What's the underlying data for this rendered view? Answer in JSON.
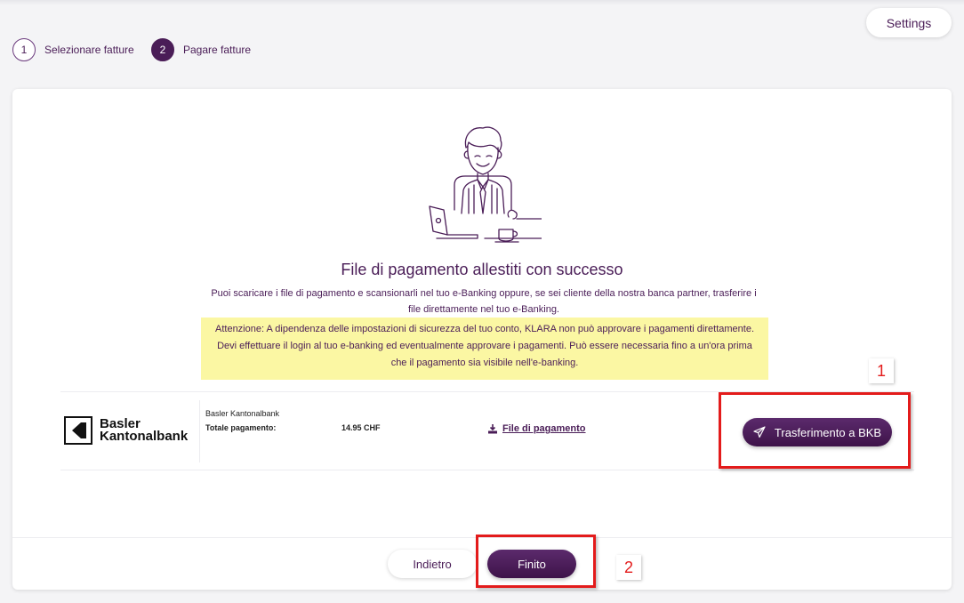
{
  "header": {
    "settings_label": "Settings"
  },
  "steps": [
    {
      "number": "1",
      "label": "Selezionare fatture"
    },
    {
      "number": "2",
      "label": "Pagare fatture"
    }
  ],
  "main": {
    "title": "File di pagamento allestiti con successo",
    "description_line1": "Puoi scaricare i file di pagamento e scansionarli nel tuo e-Banking oppure, se sei cliente della nostra banca partner, trasferire i",
    "description_line2": "file direttamente nel tuo e-Banking.",
    "warning_line1": "Attenzione: A dipendenza delle impostazioni di sicurezza del tuo conto, KLARA non può approvare i pagamenti direttamente.",
    "warning_line2": "Devi effettuare il login al tuo e-banking ed eventualmente approvare i pagamenti. Può essere necessaria fino a un'ora prima",
    "warning_line3": "che il pagamento sia visibile nell'e-banking."
  },
  "payment": {
    "logo_line1": "Basler",
    "logo_line2": "Kantonalbank",
    "bank_name": "Basler Kantonalbank",
    "total_label": "Totale pagamento:",
    "total_value": "14.95 CHF",
    "file_link": "File di pagamento",
    "transfer_button": "Trasferimento a BKB"
  },
  "footer": {
    "back_label": "Indietro",
    "finish_label": "Finito"
  },
  "annotations": {
    "marker1": "1",
    "marker2": "2"
  },
  "colors": {
    "brand": "#4a1d57",
    "warning_bg": "#fbf7a3",
    "highlight": "#e31b1b"
  },
  "icons": [
    "person-at-laptop-illustration",
    "bkb-logo-icon",
    "download-icon",
    "paper-plane-icon"
  ]
}
